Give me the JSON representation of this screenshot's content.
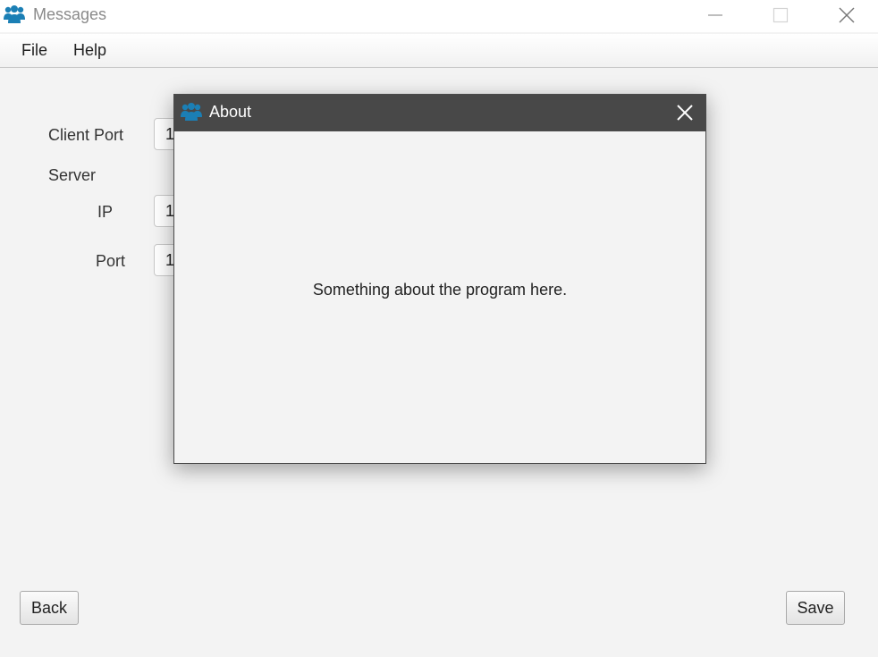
{
  "window": {
    "title": "Messages",
    "icon": "users-icon",
    "controls": [
      "minimize-icon",
      "maximize-icon",
      "close-icon"
    ]
  },
  "menu": {
    "items": [
      {
        "label": "File"
      },
      {
        "label": "Help"
      }
    ]
  },
  "form": {
    "client_port_label": "Client Port",
    "client_port_value": "1",
    "server_label": "Server",
    "ip_label": "IP",
    "ip_value": "1",
    "port_label": "Port",
    "port_value": "1"
  },
  "buttons": {
    "back": "Back",
    "save": "Save"
  },
  "dialog": {
    "title": "About",
    "icon": "users-icon",
    "message": "Something about the program here."
  },
  "colors": {
    "icon_blue": "#1b7fb5",
    "dialog_titlebar": "#484848"
  }
}
